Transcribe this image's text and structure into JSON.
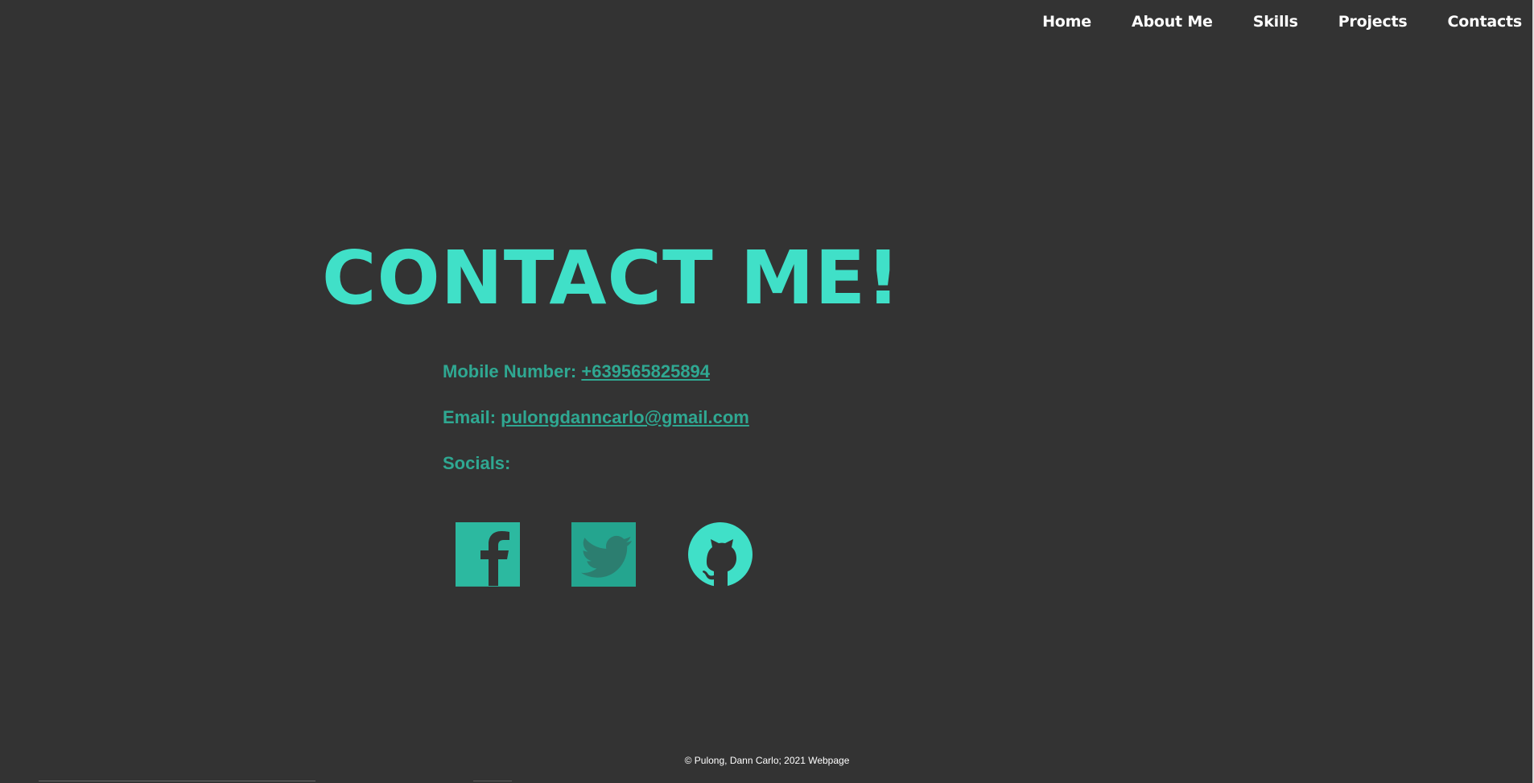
{
  "nav": {
    "items": [
      {
        "label": "Home"
      },
      {
        "label": "About Me"
      },
      {
        "label": "Skills"
      },
      {
        "label": "Projects"
      },
      {
        "label": "Contacts"
      }
    ]
  },
  "contact": {
    "title": "CONTACT ME!",
    "mobile_label": "Mobile Number:",
    "mobile_value": "+639565825894",
    "email_label": "Email:",
    "email_value": "pulongdanncarlo@gmail.com",
    "socials_label": "Socials:"
  },
  "socials": {
    "items": [
      {
        "icon": "facebook-icon"
      },
      {
        "icon": "twitter-icon"
      },
      {
        "icon": "github-icon"
      }
    ]
  },
  "footer": {
    "text": "© Pulong, Dann Carlo; 2021 Webpage"
  },
  "colors": {
    "background": "#333333",
    "accent": "#40e0c8",
    "accent_dark": "#2fa892",
    "nav_text": "#ffffff",
    "footer_text": "#ffffff"
  }
}
